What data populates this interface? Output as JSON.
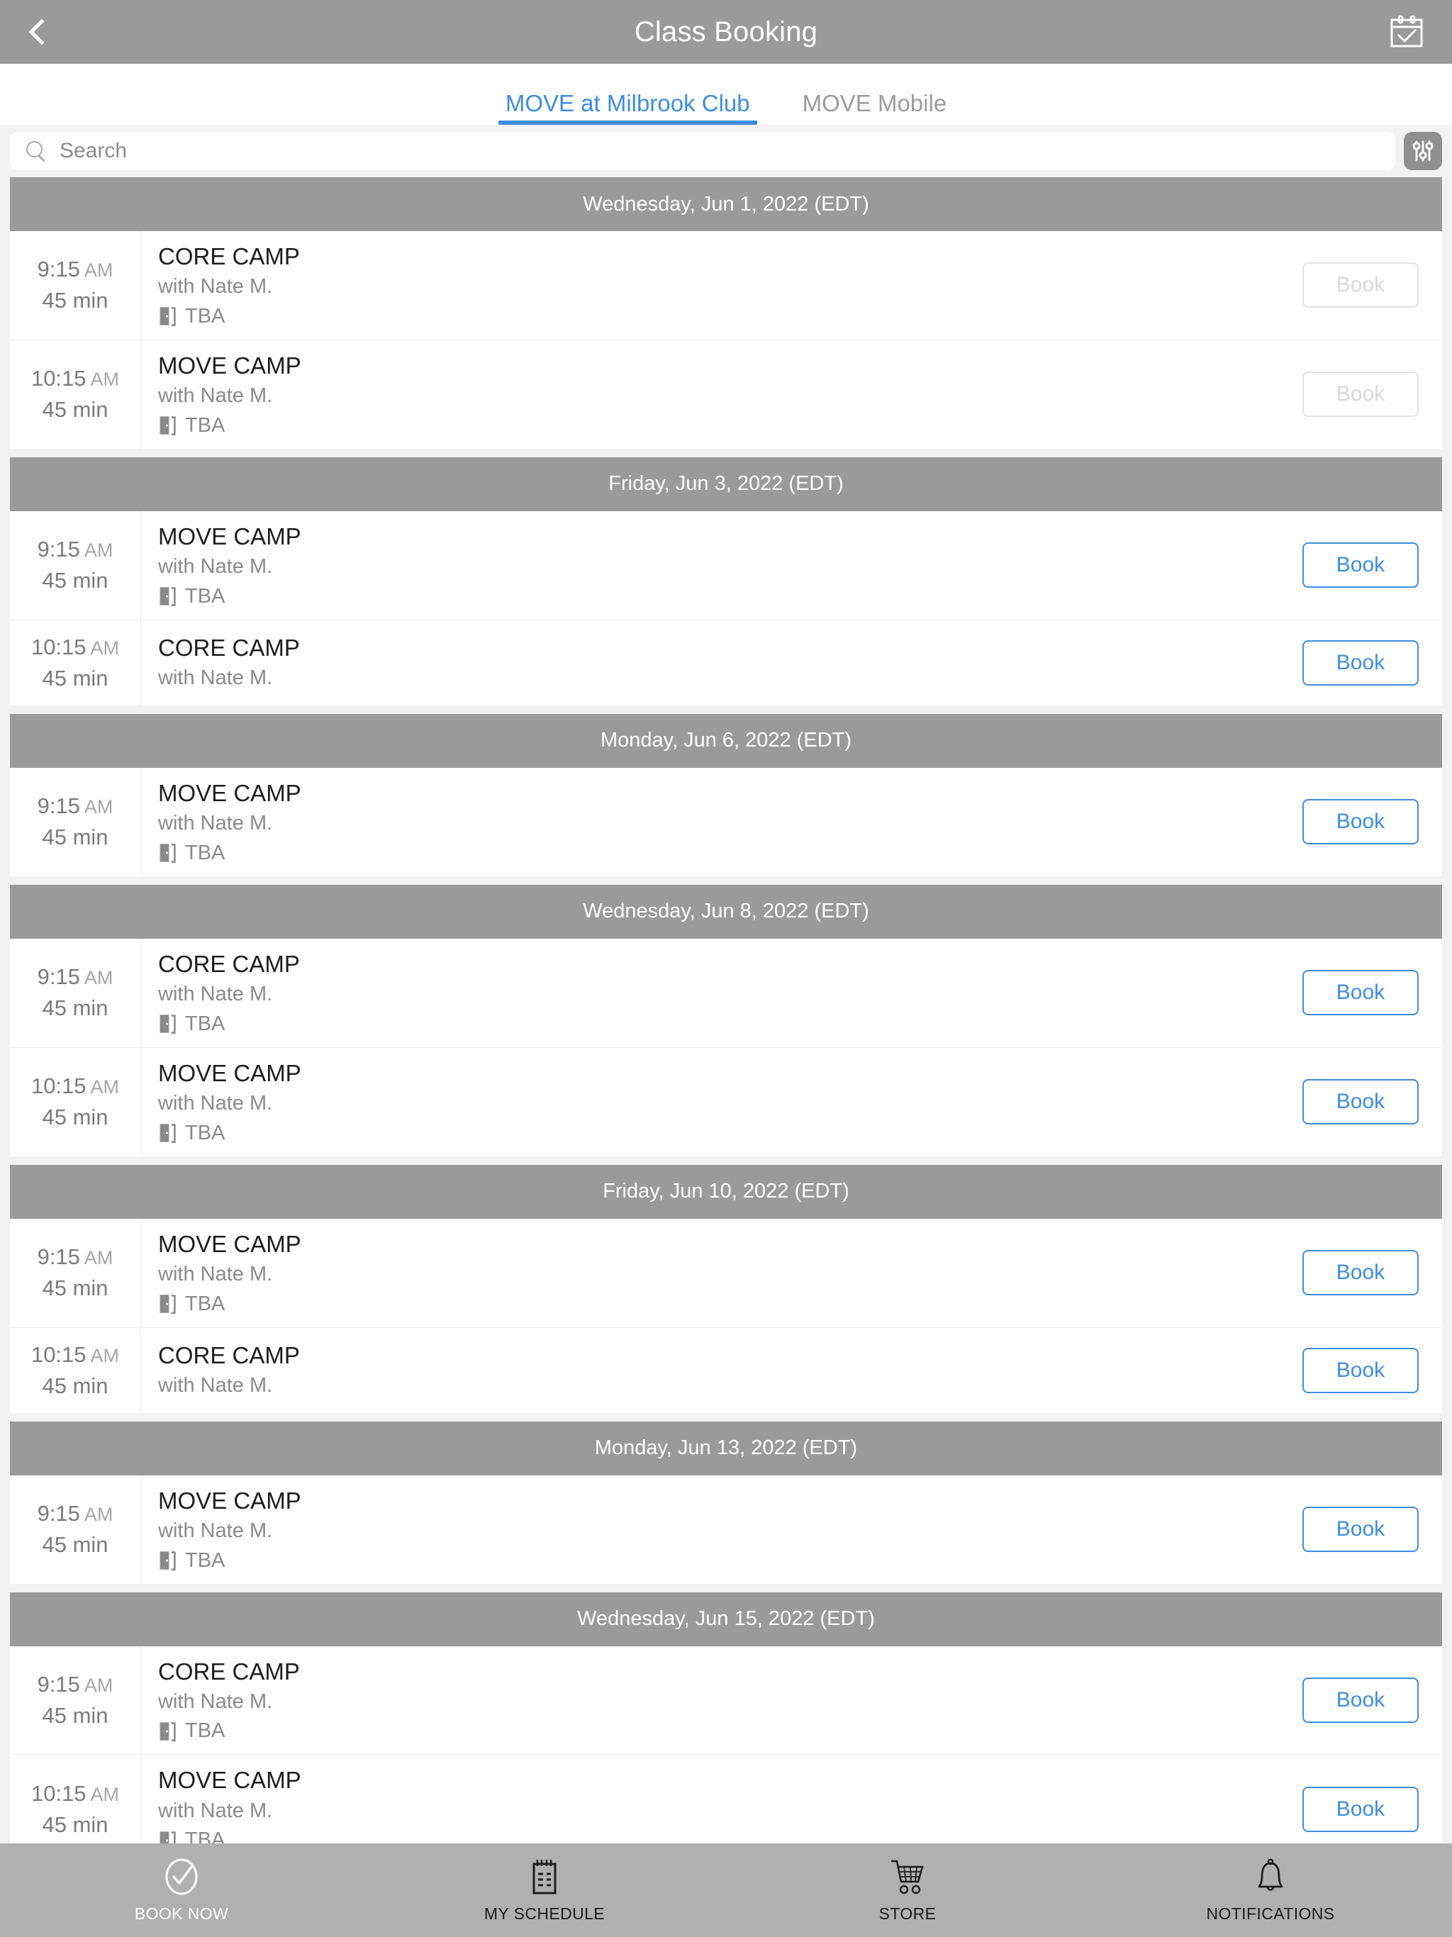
{
  "header": {
    "title": "Class Booking",
    "back_icon": "chevron-left-icon",
    "calendar_icon": "calendar-check-icon"
  },
  "tabs": [
    {
      "label": "MOVE at Milbrook Club",
      "active": true
    },
    {
      "label": "MOVE Mobile",
      "active": false
    }
  ],
  "search": {
    "placeholder": "Search",
    "value": "",
    "icon": "search-icon",
    "filter_icon": "sliders-filter-icon"
  },
  "colors": {
    "accent_blue": "#3d8ede",
    "header_gray": "#9a9a9a",
    "nav_gray": "#b0b0b0",
    "page_bg": "#f2f2f2",
    "disabled_gray": "#d8d8d8"
  },
  "book_label": "Book",
  "days": [
    {
      "header": "Wednesday, Jun 1, 2022 (EDT)",
      "classes": [
        {
          "time": "9:15",
          "ampm": "AM",
          "duration": "45 min",
          "name": "CORE CAMP",
          "staff": "with Nate M.",
          "room": "TBA",
          "has_room": true,
          "bookable": false
        },
        {
          "time": "10:15",
          "ampm": "AM",
          "duration": "45 min",
          "name": "MOVE CAMP",
          "staff": "with Nate M.",
          "room": "TBA",
          "has_room": true,
          "bookable": false
        }
      ]
    },
    {
      "header": "Friday, Jun 3, 2022 (EDT)",
      "classes": [
        {
          "time": "9:15",
          "ampm": "AM",
          "duration": "45 min",
          "name": "MOVE CAMP",
          "staff": "with Nate M.",
          "room": "TBA",
          "has_room": true,
          "bookable": true
        },
        {
          "time": "10:15",
          "ampm": "AM",
          "duration": "45 min",
          "name": "CORE CAMP",
          "staff": "with Nate M.",
          "room": "",
          "has_room": false,
          "bookable": true
        }
      ]
    },
    {
      "header": "Monday, Jun 6, 2022 (EDT)",
      "classes": [
        {
          "time": "9:15",
          "ampm": "AM",
          "duration": "45 min",
          "name": "MOVE CAMP",
          "staff": "with Nate M.",
          "room": "TBA",
          "has_room": true,
          "bookable": true
        }
      ]
    },
    {
      "header": "Wednesday, Jun 8, 2022 (EDT)",
      "classes": [
        {
          "time": "9:15",
          "ampm": "AM",
          "duration": "45 min",
          "name": "CORE CAMP",
          "staff": "with Nate M.",
          "room": "TBA",
          "has_room": true,
          "bookable": true
        },
        {
          "time": "10:15",
          "ampm": "AM",
          "duration": "45 min",
          "name": "MOVE CAMP",
          "staff": "with Nate M.",
          "room": "TBA",
          "has_room": true,
          "bookable": true
        }
      ]
    },
    {
      "header": "Friday, Jun 10, 2022 (EDT)",
      "classes": [
        {
          "time": "9:15",
          "ampm": "AM",
          "duration": "45 min",
          "name": "MOVE CAMP",
          "staff": "with Nate M.",
          "room": "TBA",
          "has_room": true,
          "bookable": true
        },
        {
          "time": "10:15",
          "ampm": "AM",
          "duration": "45 min",
          "name": "CORE CAMP",
          "staff": "with Nate M.",
          "room": "",
          "has_room": false,
          "bookable": true
        }
      ]
    },
    {
      "header": "Monday, Jun 13, 2022 (EDT)",
      "classes": [
        {
          "time": "9:15",
          "ampm": "AM",
          "duration": "45 min",
          "name": "MOVE CAMP",
          "staff": "with Nate M.",
          "room": "TBA",
          "has_room": true,
          "bookable": true
        }
      ]
    },
    {
      "header": "Wednesday, Jun 15, 2022 (EDT)",
      "classes": [
        {
          "time": "9:15",
          "ampm": "AM",
          "duration": "45 min",
          "name": "CORE CAMP",
          "staff": "with Nate M.",
          "room": "TBA",
          "has_room": true,
          "bookable": true
        },
        {
          "time": "10:15",
          "ampm": "AM",
          "duration": "45 min",
          "name": "MOVE CAMP",
          "staff": "with Nate M.",
          "room": "TBA",
          "has_room": true,
          "bookable": true
        }
      ]
    }
  ],
  "bottom_nav": [
    {
      "label": "BOOK NOW",
      "icon": "check-circle-icon",
      "active": true
    },
    {
      "label": "MY SCHEDULE",
      "icon": "notepad-calendar-icon",
      "active": false
    },
    {
      "label": "STORE",
      "icon": "shopping-cart-icon",
      "active": false
    },
    {
      "label": "NOTIFICATIONS",
      "icon": "bell-icon",
      "active": false
    }
  ]
}
